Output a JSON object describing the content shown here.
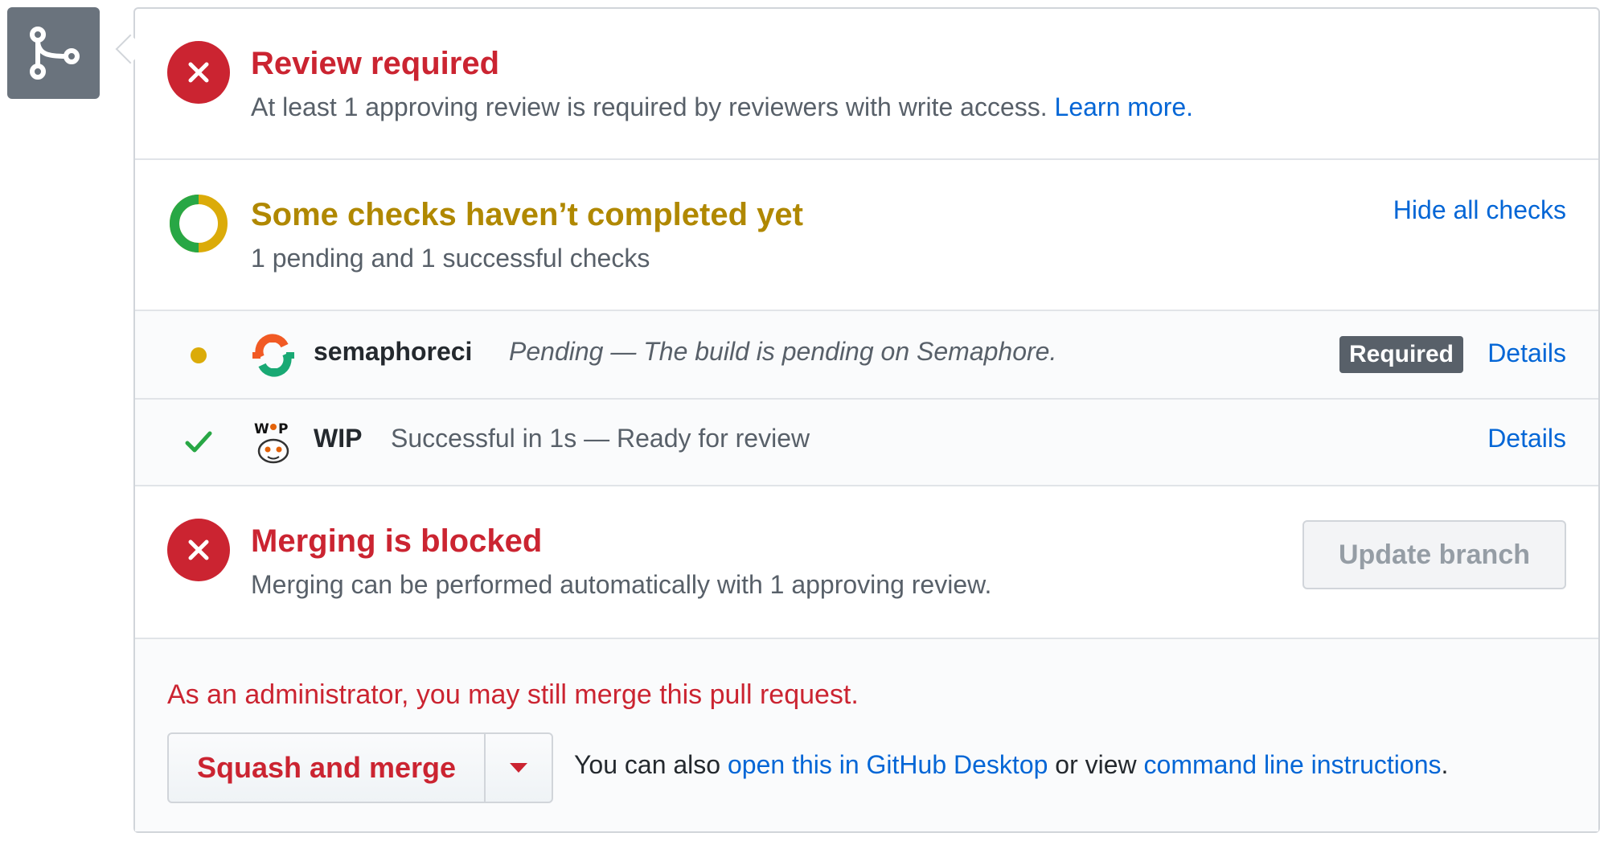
{
  "review": {
    "title": "Review required",
    "description": "At least 1 approving review is required by reviewers with write access.",
    "learn_more": "Learn more."
  },
  "checks": {
    "title": "Some checks haven’t completed yet",
    "summary": "1 pending and 1 successful checks",
    "toggle_label": "Hide all checks",
    "items": [
      {
        "status": "pending",
        "name": "semaphoreci",
        "description": "Pending — The build is pending on Semaphore.",
        "badge": "Required",
        "details_label": "Details"
      },
      {
        "status": "success",
        "name": "WIP",
        "description": "Successful in 1s — Ready for review",
        "details_label": "Details"
      }
    ]
  },
  "merge": {
    "title": "Merging is blocked",
    "description": "Merging can be performed automatically with 1 approving review.",
    "update_branch_label": "Update branch"
  },
  "admin": {
    "note": "As an administrator, you may still merge this pull request.",
    "merge_button_label": "Squash and merge",
    "also_prefix": "You can also",
    "desktop_link": "open this in GitHub Desktop",
    "or_view": "or view",
    "cli_link": "command line instructions",
    "suffix": "."
  },
  "colors": {
    "error": "#cb2431",
    "pending": "#dbab09",
    "success": "#28a745",
    "link": "#0366d6"
  },
  "icons": {
    "merge_badge": "git-merge-icon",
    "review_status": "x-circle-icon",
    "checks_status": "partial-ring-icon",
    "pending": "pending-dot-icon",
    "success": "checkmark-icon",
    "semaphore_app": "semaphore-gear-icon",
    "wip_app": "wip-robot-icon",
    "dropdown": "triangle-down-icon"
  }
}
